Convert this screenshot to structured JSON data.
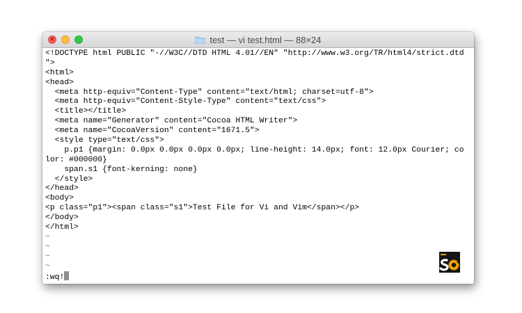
{
  "window": {
    "title": "test — vi test.html — 88×24"
  },
  "terminal": {
    "lines": [
      "<!DOCTYPE html PUBLIC \"-//W3C//DTD HTML 4.01//EN\" \"http://www.w3.org/TR/html4/strict.dtd",
      "\">",
      "<html>",
      "<head>",
      "  <meta http-equiv=\"Content-Type\" content=\"text/html; charset=utf-8\">",
      "  <meta http-equiv=\"Content-Style-Type\" content=\"text/css\">",
      "  <title></title>",
      "  <meta name=\"Generator\" content=\"Cocoa HTML Writer\">",
      "  <meta name=\"CocoaVersion\" content=\"1671.5\">",
      "  <style type=\"text/css\">",
      "    p.p1 {margin: 0.0px 0.0px 0.0px 0.0px; line-height: 14.0px; font: 12.0px Courier; co",
      "lor: #000000}",
      "    span.s1 {font-kerning: none}",
      "  </style>",
      "</head>",
      "<body>",
      "<p class=\"p1\"><span class=\"s1\">Test File for Vi and Vim</span></p>",
      "</body>",
      "</html>"
    ],
    "tildes": [
      "~",
      "~",
      "~",
      "~"
    ],
    "command": ":wq!"
  },
  "colors": {
    "tilde": "#5a5ad6",
    "close": "#fc605c",
    "minimize": "#fdbc40",
    "maximize": "#34c84a",
    "logo_background": "#151515",
    "logo_accent": "#f0a000"
  },
  "icons": {
    "close": "close-icon",
    "minimize": "minimize-icon",
    "maximize": "maximize-icon",
    "folder": "folder-icon",
    "logo": "logo-icon"
  }
}
